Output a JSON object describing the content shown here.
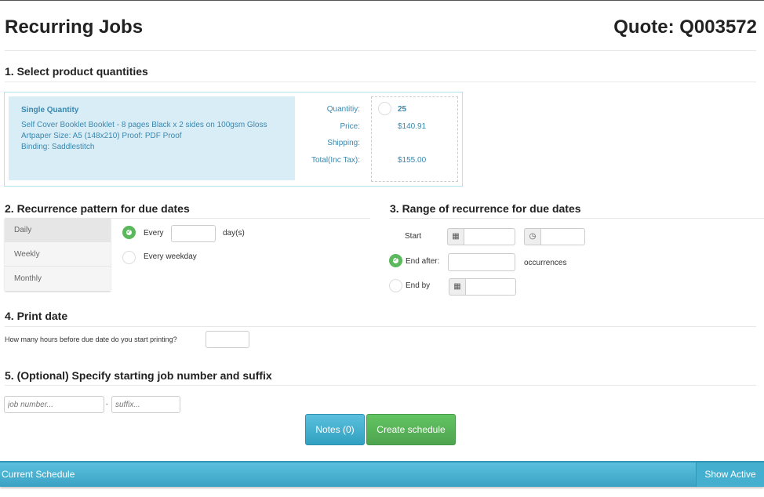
{
  "header": {
    "title": "Recurring Jobs",
    "quote": "Quote: Q003572"
  },
  "section1": {
    "heading": "1. Select product quantities",
    "product_title": "Single Quantity",
    "product_desc_line1": "Self Cover Booklet Booklet - 8 pages Black x 2 sides on 100gsm Gloss",
    "product_desc_line2": "Artpaper Size: A5 (148x210) Proof: PDF Proof",
    "product_desc_line3": "Binding: Saddlestitch",
    "labels": {
      "quantity": "Quantitiy:",
      "price": "Price:",
      "shipping": "Shipping:",
      "total": "Total(Inc Tax):"
    },
    "values": {
      "quantity": "25",
      "price": "$140.91",
      "shipping": "",
      "total": "$155.00"
    }
  },
  "section2": {
    "heading": "2. Recurrence pattern for due dates",
    "tabs": [
      "Daily",
      "Weekly",
      "Monthly"
    ],
    "every_label": "Every",
    "every_value": "",
    "days_unit": "day(s)",
    "weekday_label": "Every weekday"
  },
  "section3": {
    "heading": "3. Range of recurrence for due dates",
    "start_label": "Start",
    "end_after_label": "End after:",
    "occurrences_label": "occurrences",
    "end_by_label": "End by"
  },
  "section4": {
    "heading": "4. Print date",
    "question": "How many hours before due date do you start printing?"
  },
  "section5": {
    "heading": "5. (Optional) Specify starting job number and suffix",
    "job_placeholder": "job number...",
    "separator": "-",
    "suffix_placeholder": "suffix..."
  },
  "buttons": {
    "notes": "Notes (0)",
    "create": "Create schedule"
  },
  "schedule_bar": {
    "title": "Current Schedule",
    "show_active": "Show Active"
  },
  "colors": {
    "accent_blue": "#46b8da",
    "green": "#5cb85c",
    "product_bg": "#d9edf7"
  }
}
